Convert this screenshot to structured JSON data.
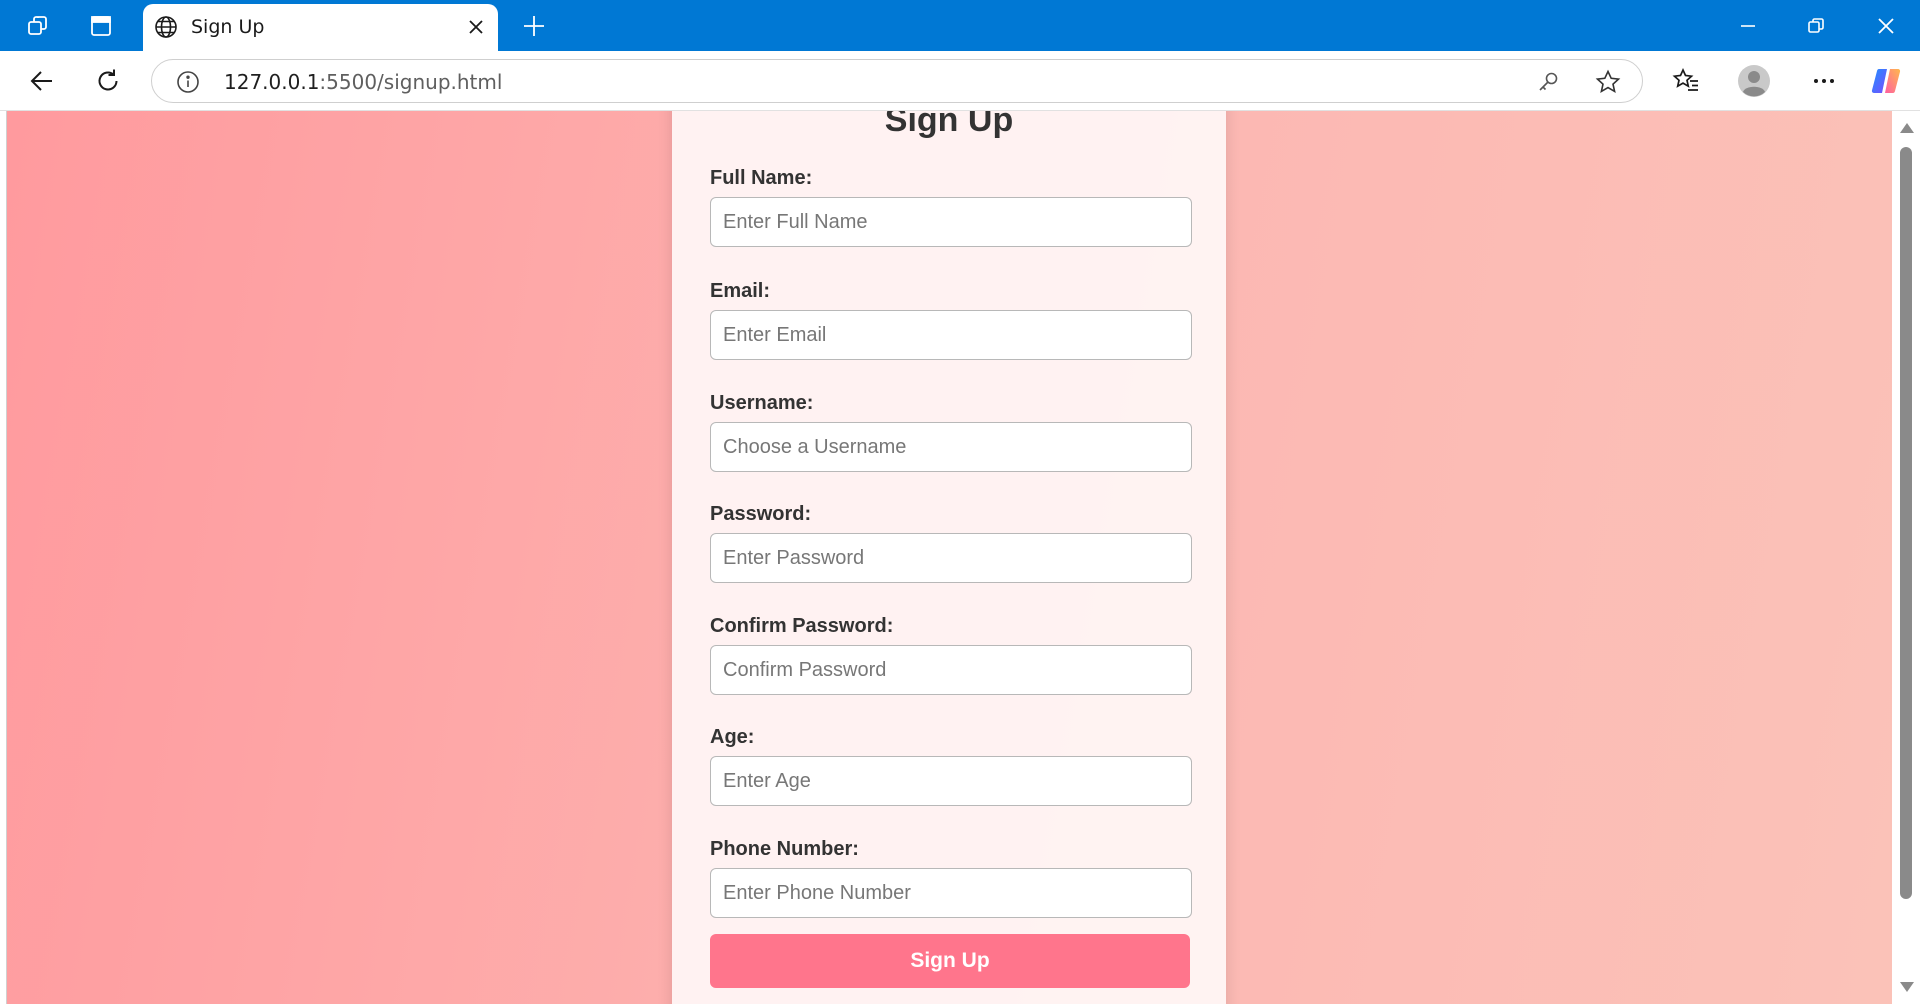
{
  "browser": {
    "tab": {
      "title": "Sign Up"
    },
    "address": {
      "host": "127.0.0.1",
      "rest": ":5500/signup.html"
    }
  },
  "form": {
    "title": "Sign Up",
    "fields": [
      {
        "label": "Full Name:",
        "placeholder": "Enter Full Name"
      },
      {
        "label": "Email:",
        "placeholder": "Enter Email"
      },
      {
        "label": "Username:",
        "placeholder": "Choose a Username"
      },
      {
        "label": "Password:",
        "placeholder": "Enter Password"
      },
      {
        "label": "Confirm Password:",
        "placeholder": "Confirm Password"
      },
      {
        "label": "Age:",
        "placeholder": "Enter Age"
      },
      {
        "label": "Phone Number:",
        "placeholder": "Enter Phone Number"
      }
    ],
    "submit_label": "Sign Up"
  },
  "colors": {
    "titlebar": "#0078d4",
    "gradient_start": "#ff9a9e",
    "gradient_end": "#fbc2b8",
    "button": "#ff758c"
  },
  "icons": {
    "workspaces": "workspaces-icon",
    "tab_actions": "tab-actions-icon",
    "globe": "globe-icon",
    "close_tab": "close-icon",
    "new_tab": "plus-icon",
    "minimize": "minimize-icon",
    "restore": "restore-icon",
    "close_window": "close-icon",
    "back": "back-arrow-icon",
    "refresh": "refresh-icon",
    "site_info": "info-icon",
    "password_key": "key-icon",
    "favorite": "star-icon",
    "favorites": "favorites-icon",
    "profile": "avatar-icon",
    "more": "more-icon",
    "copilot": "copilot-icon"
  }
}
